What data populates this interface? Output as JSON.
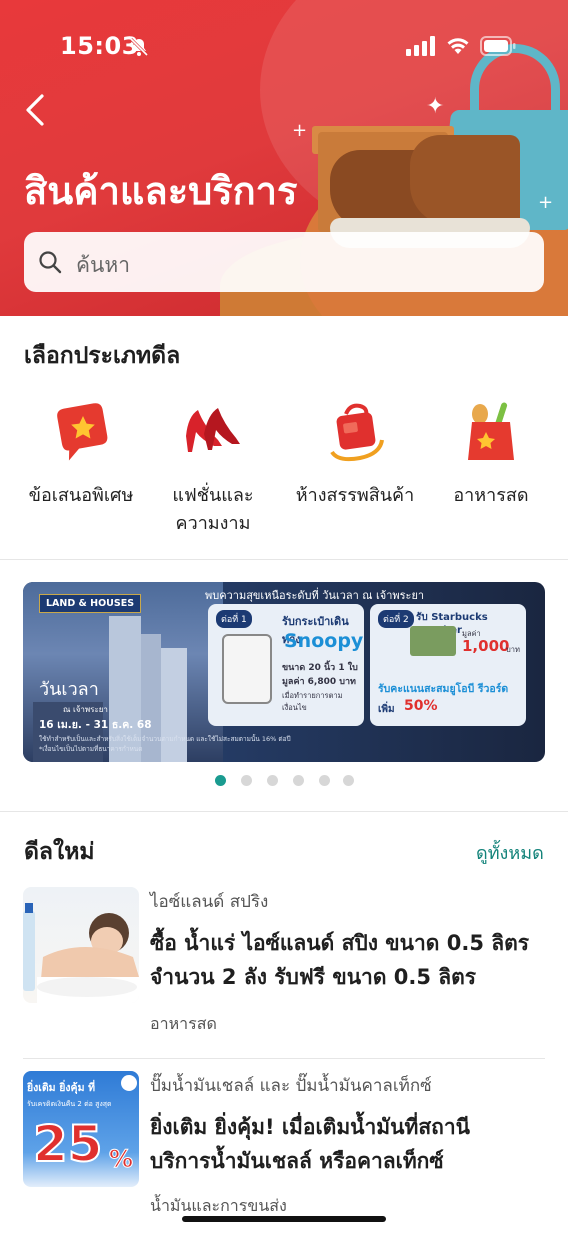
{
  "status_bar": {
    "time": "15:03"
  },
  "header": {
    "title": "สินค้าและบริการ",
    "search_placeholder": "ค้นหา"
  },
  "categories_section": {
    "title": "เลือกประเภทดีล",
    "items": [
      {
        "label": "ข้อเสนอพิเศษ",
        "icon": "special-offer-icon"
      },
      {
        "label": "แฟชั่นและ\nความงาม",
        "icon": "high-heels-icon"
      },
      {
        "label": "ห้างสรรพสินค้า",
        "icon": "shopping-bag-icon"
      },
      {
        "label": "อาหารสด",
        "icon": "grocery-bag-icon"
      }
    ]
  },
  "banner": {
    "brand": "LAND & HOUSES",
    "headline": "พบความสุขเหนือระดับที่ วันเวลา ณ เจ้าพระยา",
    "project": "วันเวลา",
    "project_sub": "ณ เจ้าพระยา",
    "dates": "16 เม.ย. - 31 ธ.ค. 68",
    "fine_print": "ใช้ทำสำหรับเป็นและสำหรับสิ่งใช้เต็มจำนวนตามกำหนด และใช้ไม่สะสมตามนั้น 16% ต่อปี",
    "fine_print2": "*เงื่อนไขเป็นไปตามที่ธนาคารกำหนด",
    "offer1": {
      "step": "ต่อที่ 1",
      "title": "รับกระเป๋าเดินทาง",
      "brand": "Snoopy",
      "size": "ขนาด 20 นิ้ว 1 ใบ",
      "value": "มูลค่า 6,800 บาท",
      "note": "เมื่อทำรายการตามเงื่อนไข"
    },
    "offer2": {
      "step": "ต่อที่ 2",
      "title": "รับ Starbucks Voucher",
      "value_label": "มูลค่า",
      "value": "1,000",
      "unit": "บาท",
      "points": "รับคะแนนสะสมยูโอบี รีวอร์ด",
      "bonus_prefix": "เพิ่ม",
      "bonus": "50%"
    }
  },
  "carousel": {
    "count": 6,
    "active": 0
  },
  "deals_section": {
    "title": "ดีลใหม่",
    "see_all": "ดูทั้งหมด",
    "deals": [
      {
        "brand": "ไอซ์แลนด์ สปริง",
        "title": "ซื้อ น้ำแร่ ไอซ์แลนด์ สปิง ขนาด 0.5 ลิตร จำนวน 2 ลัง รับฟรี ขนาด 0.5 ลิตร",
        "category": "อาหารสด"
      },
      {
        "brand": "ปั๊มน้ำมันเชลล์ และ ปั๊มน้ำมันคาลเท็กซ์",
        "title": "ยิ่งเติม ยิ่งคุ้ม! เมื่อเติมน้ำมันที่สถานีบริการน้ำมันเชลล์ หรือคาลเท็กซ์",
        "category": "น้ำมันและการขนส่ง",
        "thumb_headline": "ยิ่งเติม ยิ่งคุ้ม ที่",
        "thumb_sub": "รับเครดิตเงินคืน 2 ต่อ สูงสุด",
        "thumb_big": "25",
        "thumb_pct": "%"
      }
    ]
  }
}
